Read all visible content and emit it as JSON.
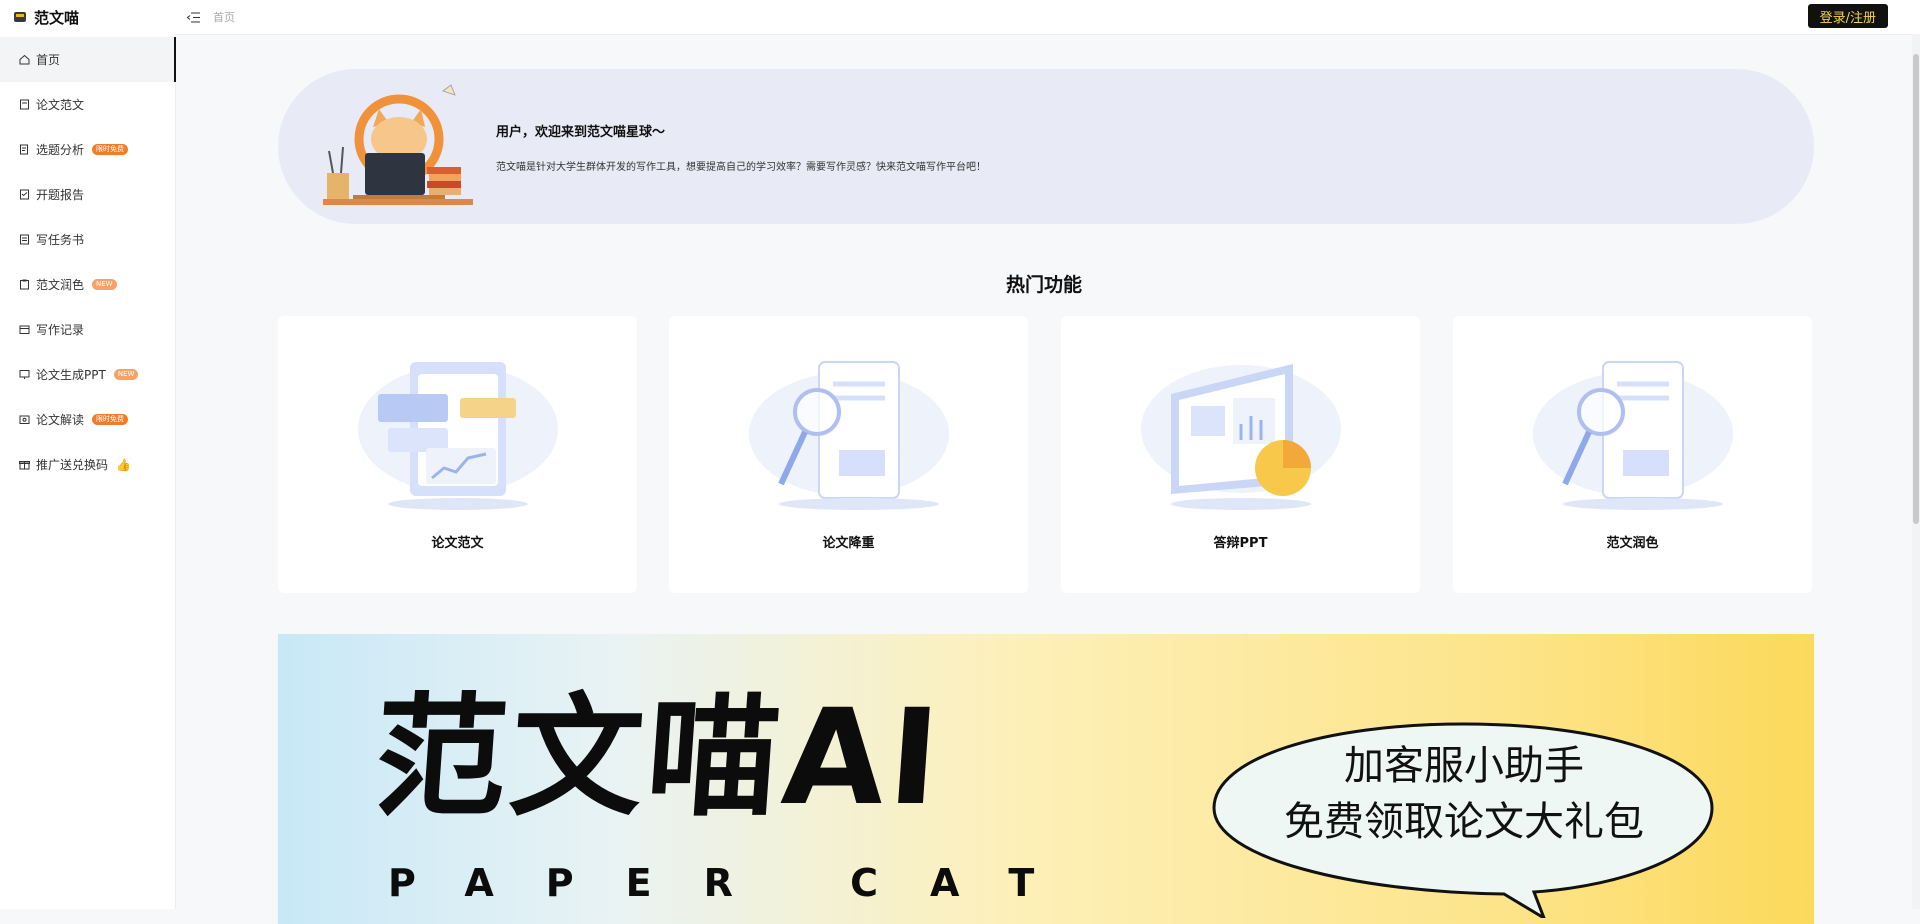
{
  "brand": {
    "name": "范文喵"
  },
  "sidebar": {
    "items": [
      {
        "label": "首页",
        "badge": ""
      },
      {
        "label": "论文范文",
        "badge": ""
      },
      {
        "label": "选题分析",
        "badge": "限时免费"
      },
      {
        "label": "开题报告",
        "badge": ""
      },
      {
        "label": "写任务书",
        "badge": ""
      },
      {
        "label": "范文润色",
        "badge": "NEW"
      },
      {
        "label": "写作记录",
        "badge": ""
      },
      {
        "label": "论文生成PPT",
        "badge": "NEW"
      },
      {
        "label": "论文解读",
        "badge": "限时免费"
      },
      {
        "label": "推广送兑换码",
        "badge": ""
      }
    ]
  },
  "topbar": {
    "breadcrumb": "首页",
    "login_label": "登录/注册"
  },
  "welcome": {
    "title": "用户，欢迎来到范文喵星球～",
    "description": "范文喵是针对大学生群体开发的写作工具，想要提高自己的学习效率？需要写作灵感？快来范文喵写作平台吧！"
  },
  "features": {
    "title": "热门功能",
    "cards": [
      {
        "label": "论文范文"
      },
      {
        "label": "论文降重"
      },
      {
        "label": "答辩PPT"
      },
      {
        "label": "范文润色"
      }
    ]
  },
  "promo": {
    "title": "范文喵AI",
    "subtitle": "PAPER CAT",
    "bubble_line1": "加客服小助手",
    "bubble_line2": "免费领取论文大礼包"
  },
  "colors": {
    "accent": "#111111",
    "login_text": "#f3d54a",
    "badge": "#f07c2a"
  }
}
